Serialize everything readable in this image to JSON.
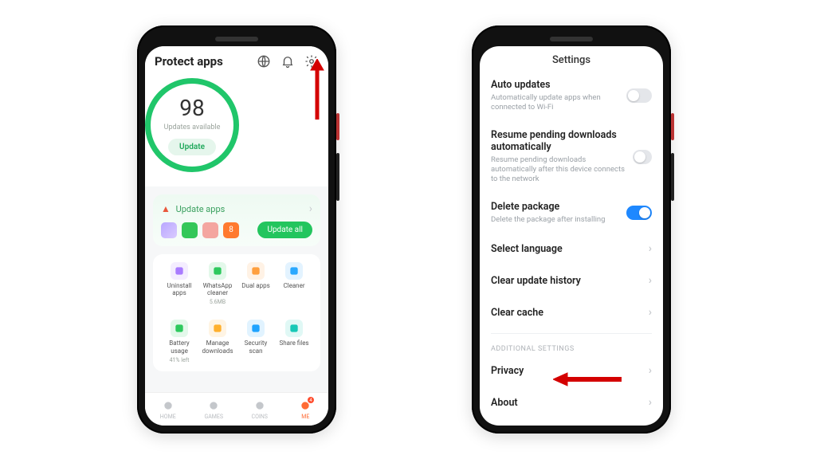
{
  "left": {
    "header": {
      "title": "Protect apps"
    },
    "ring": {
      "score": "98",
      "sub": "Updates available",
      "button": "Update"
    },
    "update_card": {
      "title": "Update apps",
      "badge_count": "8",
      "button": "Update all"
    },
    "tools": [
      {
        "label": "Uninstall apps",
        "sub": "",
        "color": "#a97bff"
      },
      {
        "label": "WhatsApp cleaner",
        "sub": "5.6MB",
        "color": "#2ec95e"
      },
      {
        "label": "Dual apps",
        "sub": "",
        "color": "#ff9f3e"
      },
      {
        "label": "Cleaner",
        "sub": "",
        "color": "#2aa8ff"
      },
      {
        "label": "Battery usage",
        "sub": "41% left",
        "color": "#2ec95e"
      },
      {
        "label": "Manage downloads",
        "sub": "",
        "color": "#ffb02e"
      },
      {
        "label": "Security scan",
        "sub": "",
        "color": "#1fa3ff"
      },
      {
        "label": "Share files",
        "sub": "",
        "color": "#17c8b6"
      }
    ],
    "tabs": [
      {
        "label": "HOME"
      },
      {
        "label": "GAMES"
      },
      {
        "label": "COINS"
      },
      {
        "label": "ME",
        "badge": "4"
      }
    ]
  },
  "right": {
    "header": "Settings",
    "items": {
      "auto_updates": {
        "title": "Auto updates",
        "sub": "Automatically update apps when connected to Wi-Fi",
        "on": false
      },
      "resume": {
        "title": "Resume pending downloads automatically",
        "sub": "Resume pending downloads automatically after this device connects to the network",
        "on": false
      },
      "delete_pkg": {
        "title": "Delete package",
        "sub": "Delete the package after installing",
        "on": true
      },
      "select_language": {
        "title": "Select language"
      },
      "clear_history": {
        "title": "Clear update history"
      },
      "clear_cache": {
        "title": "Clear cache"
      },
      "section": "ADDITIONAL SETTINGS",
      "privacy": {
        "title": "Privacy"
      },
      "about": {
        "title": "About"
      }
    }
  }
}
